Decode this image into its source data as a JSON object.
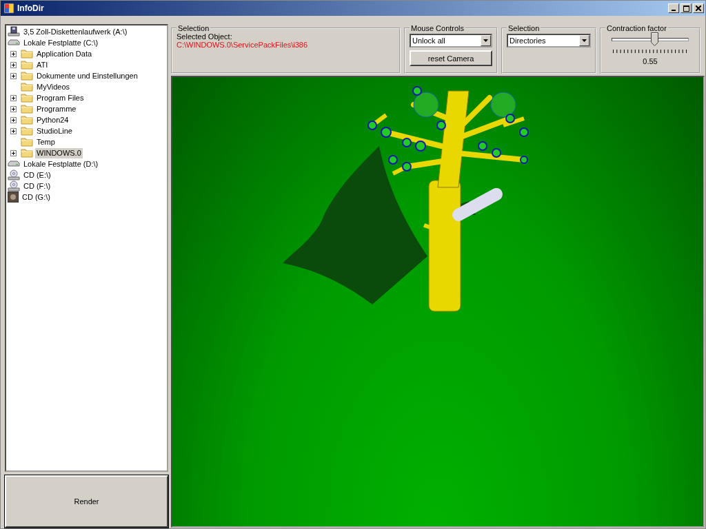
{
  "window": {
    "title": "InfoDir"
  },
  "tree": [
    {
      "label": "3,5 Zoll-Diskettenlaufwerk (A:\\)",
      "kind": "floppy",
      "selected": false
    },
    {
      "label": "Lokale Festplatte (C:\\)",
      "kind": "disk",
      "selected": false,
      "children": [
        {
          "label": "Application Data",
          "kind": "folder",
          "collapsed": true,
          "selected": false
        },
        {
          "label": "ATI",
          "kind": "folder",
          "collapsed": true,
          "selected": false
        },
        {
          "label": "Dokumente und Einstellungen",
          "kind": "folder",
          "collapsed": true,
          "selected": false
        },
        {
          "label": "MyVideos",
          "kind": "folder",
          "collapsed": false,
          "selected": false
        },
        {
          "label": "Program Files",
          "kind": "folder",
          "collapsed": true,
          "selected": false
        },
        {
          "label": "Programme",
          "kind": "folder",
          "collapsed": true,
          "selected": false
        },
        {
          "label": "Python24",
          "kind": "folder",
          "collapsed": true,
          "selected": false
        },
        {
          "label": "StudioLine",
          "kind": "folder",
          "collapsed": true,
          "selected": false
        },
        {
          "label": "Temp",
          "kind": "folder",
          "collapsed": false,
          "selected": false
        },
        {
          "label": "WINDOWS.0",
          "kind": "folder",
          "collapsed": true,
          "selected": true
        }
      ]
    },
    {
      "label": "Lokale Festplatte (D:\\)",
      "kind": "disk",
      "selected": false
    },
    {
      "label": "CD (E:\\)",
      "kind": "cd",
      "selected": false
    },
    {
      "label": "CD (F:\\)",
      "kind": "cd",
      "selected": false
    },
    {
      "label": "CD (G:\\)",
      "kind": "media",
      "selected": false
    }
  ],
  "render_button": "Render",
  "selection_info": {
    "title": "Selection",
    "label": "Selected Object:",
    "path": "C:\\WINDOWS.0\\ServicePackFiles\\i386"
  },
  "mouse_controls": {
    "title": "Mouse Controls",
    "mode": "Unlock all",
    "button": "reset Camera"
  },
  "selection_mode": {
    "title": "Selection",
    "value": "Directories"
  },
  "contraction": {
    "title": "Contraction factor",
    "level": 0.55,
    "reading": "0.55"
  }
}
